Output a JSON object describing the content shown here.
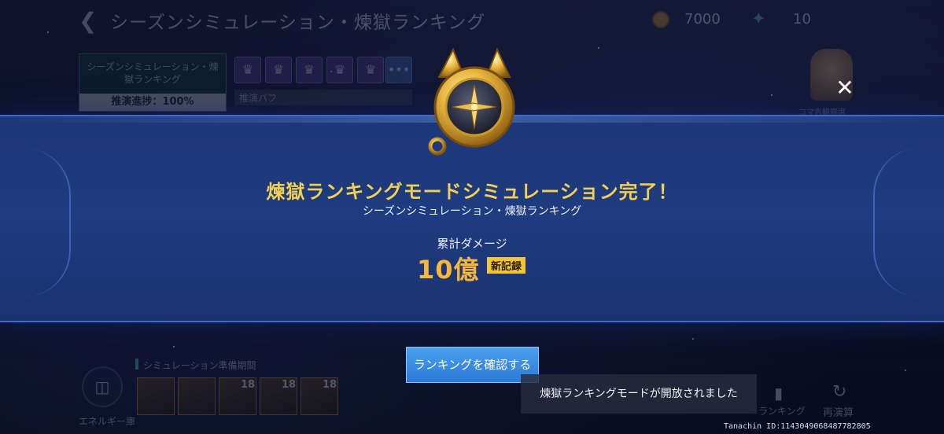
{
  "header": {
    "title": "シーズンシミュレーション・煉獄ランキング",
    "coins": "7000",
    "gems": "10"
  },
  "mode_card": {
    "title": "シーズンシミュレーション・煉獄ランキング",
    "progress": "推演進捗：100%"
  },
  "buffs": {
    "label": "推演バフ",
    "more": "•••"
  },
  "pet": {
    "caption": "コマ吉観察席"
  },
  "preparation": {
    "label": "シミュレーション準備期間",
    "energy_label": "エネルギー庫",
    "levels": [
      "18",
      "18",
      "18"
    ]
  },
  "actions": {
    "ranking_label": "ランキング",
    "replay_label": "再演算"
  },
  "result": {
    "title": "煉獄ランキングモードシミュレーション完了！",
    "subtitle": "シーズンシミュレーション・煉獄ランキング",
    "damage_label": "累計ダメージ",
    "damage_value": "10億",
    "record_badge": "新記録"
  },
  "confirm_button_label": "ランキングを確認する",
  "toast_message": "煉獄ランキングモードが開放されました",
  "footer_id": "Tanachin ID:1143049068487782805",
  "colors": {
    "banner": "#1f3c80",
    "title_gold": "#f3cf52",
    "damage_orange": "#f7b73a",
    "button_blue": "#2b79d6"
  }
}
